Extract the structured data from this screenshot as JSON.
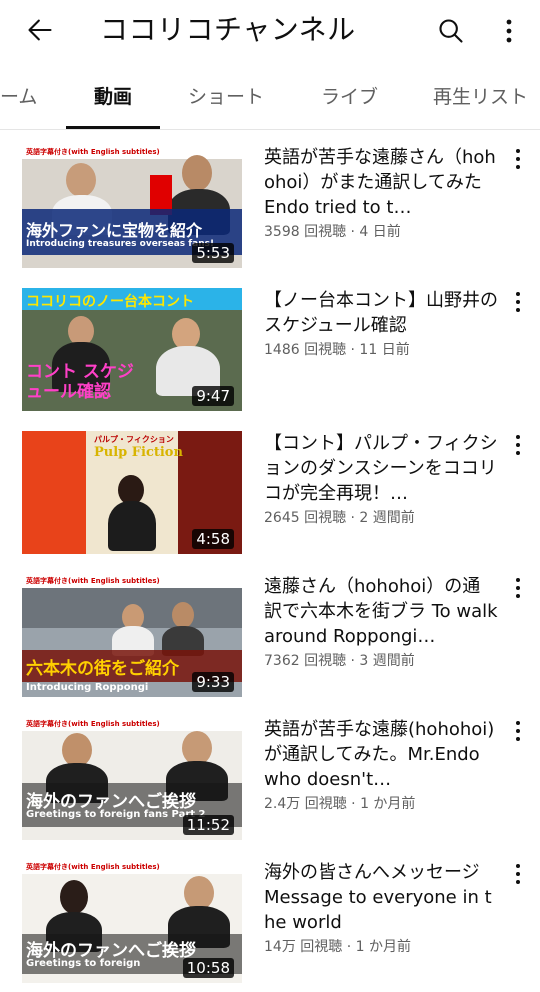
{
  "header": {
    "title": "ココリコチャンネル",
    "back_icon": "arrow-left-icon",
    "search_icon": "search-icon",
    "more_icon": "more-vertical-icon"
  },
  "tabs": [
    {
      "label": "ーム",
      "active": false
    },
    {
      "label": "動画",
      "active": true
    },
    {
      "label": "ショート",
      "active": false
    },
    {
      "label": "ライブ",
      "active": false
    },
    {
      "label": "再生リスト",
      "active": false
    }
  ],
  "videos": [
    {
      "title": "英語が苦手な遠藤さん（hohohoi）がまた通訳してみた　Endo tried to t…",
      "stats": "3598 回視聴 · 4 日前",
      "duration": "5:53"
    },
    {
      "title": "【ノー台本コント】山野井のスケジュール確認",
      "stats": "1486 回視聴 · 11 日前",
      "duration": "9:47"
    },
    {
      "title": "【コント】パルプ・フィクションのダンスシーンをココリコが完全再現！…",
      "stats": "2645 回視聴 · 2 週間前",
      "duration": "4:58"
    },
    {
      "title": "遠藤さん（hohohoi）の通訳で六本木を街ブラ To walk around Roppongi…",
      "stats": "7362 回視聴 · 3 週間前",
      "duration": "9:33"
    },
    {
      "title": "英語が苦手な遠藤(hohohoi)が通訳してみた。Mr.Endo who doesn't…",
      "stats": "2.4万 回視聴 · 1 か月前",
      "duration": "11:52"
    },
    {
      "title": "海外の皆さんへメッセージ　Message to everyone in the world",
      "stats": "14万 回視聴 · 1 か月前",
      "duration": "10:58"
    }
  ],
  "thumbnails": [
    {
      "top_caption": "英語字幕付き(with English subtitles)",
      "caption": "海外ファンに宝物を紹介",
      "sub_caption": "Introducing treasures overseas fans!"
    },
    {
      "top_caption": "ココリコのノー台本コント",
      "caption": "コント スケジュール確認",
      "sub_caption": ""
    },
    {
      "top_caption": "パルプ・フィクション",
      "caption": "Pulp Fiction",
      "sub_caption": ""
    },
    {
      "top_caption": "英語字幕付き(with English subtitles)",
      "caption": "六本木の街をご紹介",
      "sub_caption": "Introducing Roppongi"
    },
    {
      "top_caption": "英語字幕付き(with English subtitles)",
      "caption": "海外のファンへご挨拶",
      "sub_caption": "Greetings to foreign fans Part 2"
    },
    {
      "top_caption": "英語字幕付き(with English subtitles)",
      "caption": "海外のファンへご挨拶",
      "sub_caption": "Greetings to foreign"
    }
  ],
  "colors": {
    "text_primary": "#0f0f0f",
    "text_secondary": "#606060",
    "divider": "#e5e5e5"
  }
}
